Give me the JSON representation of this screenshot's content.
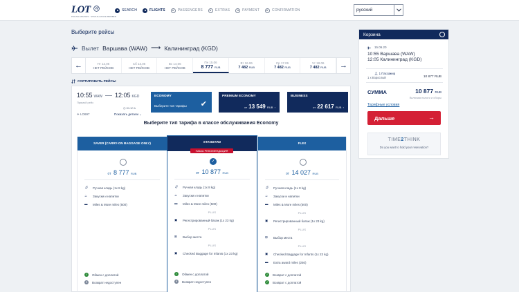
{
  "header": {
    "logo_text": "LOT",
    "logo_sub": "POLISH AIRLINES · STAR ALLIANCE MEMBER",
    "steps": [
      {
        "label": "SEARCH",
        "state": "done"
      },
      {
        "label": "FLIGHTS",
        "state": "active"
      },
      {
        "label": "PASSENGERS",
        "state": "todo"
      },
      {
        "label": "EXTRAS",
        "state": "todo"
      },
      {
        "label": "PAYMENT",
        "state": "todo"
      },
      {
        "label": "CONFIRMATION",
        "state": "todo"
      }
    ],
    "language": "русский"
  },
  "page_title": "Выберите рейсы",
  "route": {
    "prefix": "Вылет",
    "from": "Варшава (WAW)",
    "to": "Калининград (KGD)"
  },
  "dates": [
    {
      "date": "Пт 12.06",
      "price": "НЕТ РЕЙСОВ",
      "none": true
    },
    {
      "date": "Сб 13.06",
      "price": "НЕТ РЕЙСОВ",
      "none": true
    },
    {
      "date": "Вс 14.06",
      "price": "НЕТ РЕЙСОВ",
      "none": true
    },
    {
      "date": "Пн 15.06",
      "price": "8 777",
      "currency": "RUB",
      "selected": true
    },
    {
      "date": "Вт 16.06",
      "price": "7 482",
      "currency": "RUB"
    },
    {
      "date": "Ср 17.06",
      "price": "7 482",
      "currency": "RUB"
    },
    {
      "date": "Чт 18.06",
      "price": "7 482",
      "currency": "RUB"
    }
  ],
  "sort_label": "СОРТИРОВАТЬ РЕЙСЫ",
  "flight": {
    "dep_time": "10:55",
    "dep_code": "WAW",
    "arr_time": "12:05",
    "arr_code": "KGD",
    "direct": "Прямой рейс",
    "duration": "01:10 h",
    "number": "LO697",
    "details": "Показать детали"
  },
  "cabins": {
    "economy": {
      "name": "ECONOMY",
      "sub": "Выберите тип тарифы"
    },
    "premium": {
      "name": "PREMIUM ECONOMY",
      "ot": "от",
      "price": "13 549",
      "currency": "RUB"
    },
    "business": {
      "name": "BUSINESS",
      "ot": "от",
      "price": "22 617",
      "currency": "RUB"
    }
  },
  "choose_title": "Выберите тип тарифа в классе обслуживания Economy",
  "fares": [
    {
      "name": "SAVER (CARRY-ON BAGGAGE ONLY)",
      "ot": "от",
      "price": "8 777",
      "currency": "RUB",
      "features": [
        "Ручная кладь (1x 8 kg)",
        "Закуски и напитки",
        "Miles & More miles (500)"
      ],
      "plus_label": "",
      "extras": [],
      "status": [
        {
          "text": "Обмен с доплатой",
          "ok": true
        },
        {
          "text": "Возврат недоступен",
          "ok": false
        }
      ]
    },
    {
      "name": "STANDARD",
      "badge": "НАША РЕКОМЕНДАЦИЯ",
      "ot": "от",
      "price": "10 877",
      "currency": "RUB",
      "features": [
        "Ручная кладь (1x 8 kg)",
        "Закуски и напитки",
        "Miles & More miles (500)"
      ],
      "plus_label": "PLUS",
      "extras": [
        "Регистрированный багаж (1x 23 kg)",
        "Выбор места",
        "Checked Baggage for Infants (1x 23 kg)"
      ],
      "status": [
        {
          "text": "Обмен с доплатой",
          "ok": true
        },
        {
          "text": "Возврат недоступен",
          "ok": false
        }
      ]
    },
    {
      "name": "FLEX",
      "ot": "от",
      "price": "14 027",
      "currency": "RUB",
      "features": [
        "Ручная кладь (1x 8 kg)",
        "Закуски и напитки",
        "Miles & More miles (500)"
      ],
      "plus_label": "PLUS",
      "extras": [
        "Регистрированный багаж (1x 23 kg)",
        "Выбор места",
        "Checked Baggage for Infants (1x 23 kg)",
        "Extra award miles (250)"
      ],
      "status": [
        {
          "text": "Возврат с доплатой",
          "ok": true
        },
        {
          "text": "Возврат с доплатой",
          "ok": true
        }
      ]
    }
  ],
  "cart": {
    "title": "Корзина",
    "date": "15.06.20",
    "seg1": "10:55 Варшава (WAW)",
    "seg2": "12:05 Калининград (KGD)",
    "passenger_count": "1 Пассажир",
    "passenger_type": "1 x Взрослый",
    "passenger_amount": "10 877 RUB",
    "sum_label": "СУММА",
    "sum_amount": "10 877",
    "sum_currency": "RUB",
    "included": "Включая налоги и сборы",
    "terms": "Тарифные условия",
    "next_button": "Дальше",
    "ttt_title_a": "TIME",
    "ttt_title_b": "2",
    "ttt_title_c": "THINK",
    "ttt_sub": "Do you want to hold your reservation?"
  },
  "colors": {
    "brand": "#112a5c",
    "accent": "#1d5fa0",
    "cta": "#d42035"
  }
}
